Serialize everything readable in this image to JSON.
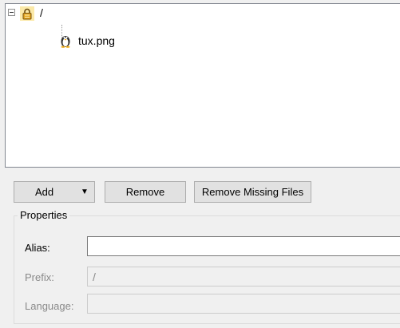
{
  "tree": {
    "root": {
      "label": "/",
      "expanded": true,
      "icon": "folder-lock-icon"
    },
    "children": [
      {
        "label": "tux.png",
        "icon": "penguin-file-icon"
      }
    ]
  },
  "toolbar": {
    "add_label": "Add",
    "remove_label": "Remove",
    "remove_missing_label": "Remove Missing Files"
  },
  "properties": {
    "title": "Properties",
    "alias": {
      "label": "Alias:",
      "value": ""
    },
    "prefix": {
      "label": "Prefix:",
      "value": "/"
    },
    "language": {
      "label": "Language:",
      "value": ""
    }
  }
}
